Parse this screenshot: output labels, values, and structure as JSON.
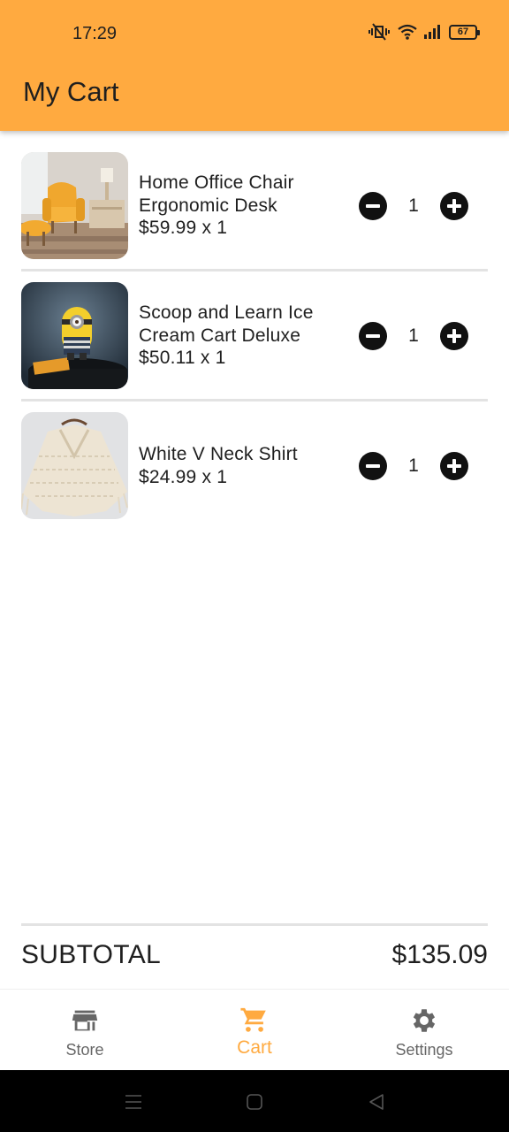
{
  "status_bar": {
    "time": "17:29",
    "battery": "67",
    "icons": [
      "mute-vibrate-icon",
      "wifi-icon",
      "signal-icon",
      "battery-icon"
    ]
  },
  "header": {
    "title": "My Cart",
    "background_color": "#ffaa40"
  },
  "cart": {
    "items": [
      {
        "name_line1": "Home Office Chair",
        "name_line2": "Ergonomic Desk",
        "price": "$59.99 x 1",
        "quantity": "1",
        "image": "armchair-photo"
      },
      {
        "name_line1": "Scoop and Learn Ice",
        "name_line2": "Cream Cart Deluxe",
        "price": "$50.11 x 1",
        "quantity": "1",
        "image": "minion-figure-photo"
      },
      {
        "name_line1": "White V Neck Shirt",
        "name_line2": "",
        "price": "$24.99 x 1",
        "quantity": "1",
        "image": "knit-poncho-photo"
      }
    ]
  },
  "summary": {
    "label": "SUBTOTAL",
    "value": "$135.09"
  },
  "bottom_nav": {
    "active_color": "#ffaa40",
    "items": [
      {
        "label": "Store",
        "icon": "store-icon"
      },
      {
        "label": "Cart",
        "icon": "cart-icon"
      },
      {
        "label": "Settings",
        "icon": "gear-icon"
      }
    ]
  },
  "system_nav": {
    "buttons": [
      "menu-icon",
      "home-icon",
      "back-icon"
    ]
  }
}
